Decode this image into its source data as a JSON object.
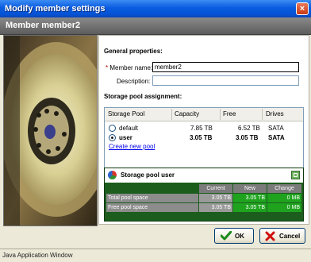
{
  "window": {
    "title": "Modify member settings",
    "close_label": "×"
  },
  "header": {
    "title": "Member member2"
  },
  "general": {
    "title": "General properties:",
    "member_name_required": "*",
    "member_name_label": " Member name:",
    "member_name_value": "member2",
    "description_label": "Description:",
    "description_value": ""
  },
  "assignment": {
    "title": "Storage pool assignment:",
    "columns": [
      "Storage Pool",
      "Capacity",
      "Free",
      "Drives"
    ],
    "rows": [
      {
        "name": "default",
        "capacity": "7.85 TB",
        "free": "6.52 TB",
        "drives": "SATA",
        "selected": false
      },
      {
        "name": "user",
        "capacity": "3.05 TB",
        "free": "3.05 TB",
        "drives": "SATA",
        "selected": true
      }
    ],
    "create_link": "Create new pool"
  },
  "pool_summary": {
    "title": "Storage pool user",
    "columns": [
      "Current",
      "New",
      "Change"
    ],
    "rows": [
      {
        "label": "Total pool space",
        "current": "3.05 TB",
        "new": "3.05 TB",
        "change": "0 MB"
      },
      {
        "label": "Free pool space",
        "current": "3.05 TB",
        "new": "3.05 TB",
        "change": "0 MB"
      }
    ]
  },
  "buttons": {
    "ok": "OK",
    "cancel": "Cancel"
  },
  "status": {
    "text": "Java Application Window"
  },
  "icons": {
    "ok": "check-icon",
    "cancel": "x-icon",
    "pool": "pie-chart-icon",
    "close": "close-icon"
  },
  "colors": {
    "title_bar": "#0a5ce0",
    "header": "#6e6e6e",
    "pool_box": "#1c5d1e",
    "change_green": "#1fa31f",
    "required": "#c00000"
  }
}
